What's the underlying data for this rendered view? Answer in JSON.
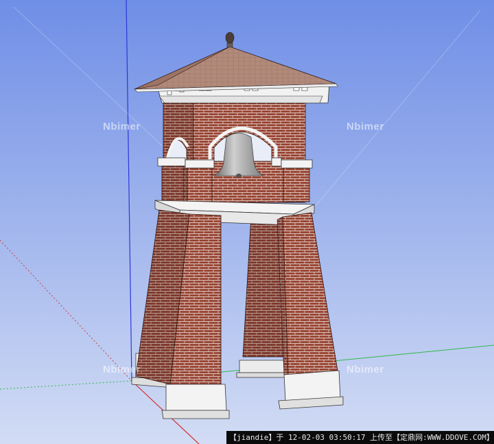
{
  "viewport": {
    "sky_top": "#6f8ee6",
    "sky_bottom": "#cfd9f3",
    "brick_color": "#9a4636",
    "mortar_color": "#d8c6bc",
    "roof_color": "#b28a7a",
    "trim_color": "#f1f1f1",
    "axis_blue": "#2c35d8",
    "axis_red": "#d42a2a",
    "axis_green": "#2fb84b"
  },
  "watermarks": {
    "w1": "Nbimer",
    "w2": "Nbimer",
    "w3": "Nbimer",
    "w4": "Nbimer"
  },
  "footer": {
    "text": "【jiandie】于 12-02-03 03:50:17 上传至【定鼎网:WWW.DDOVE.COM】"
  }
}
